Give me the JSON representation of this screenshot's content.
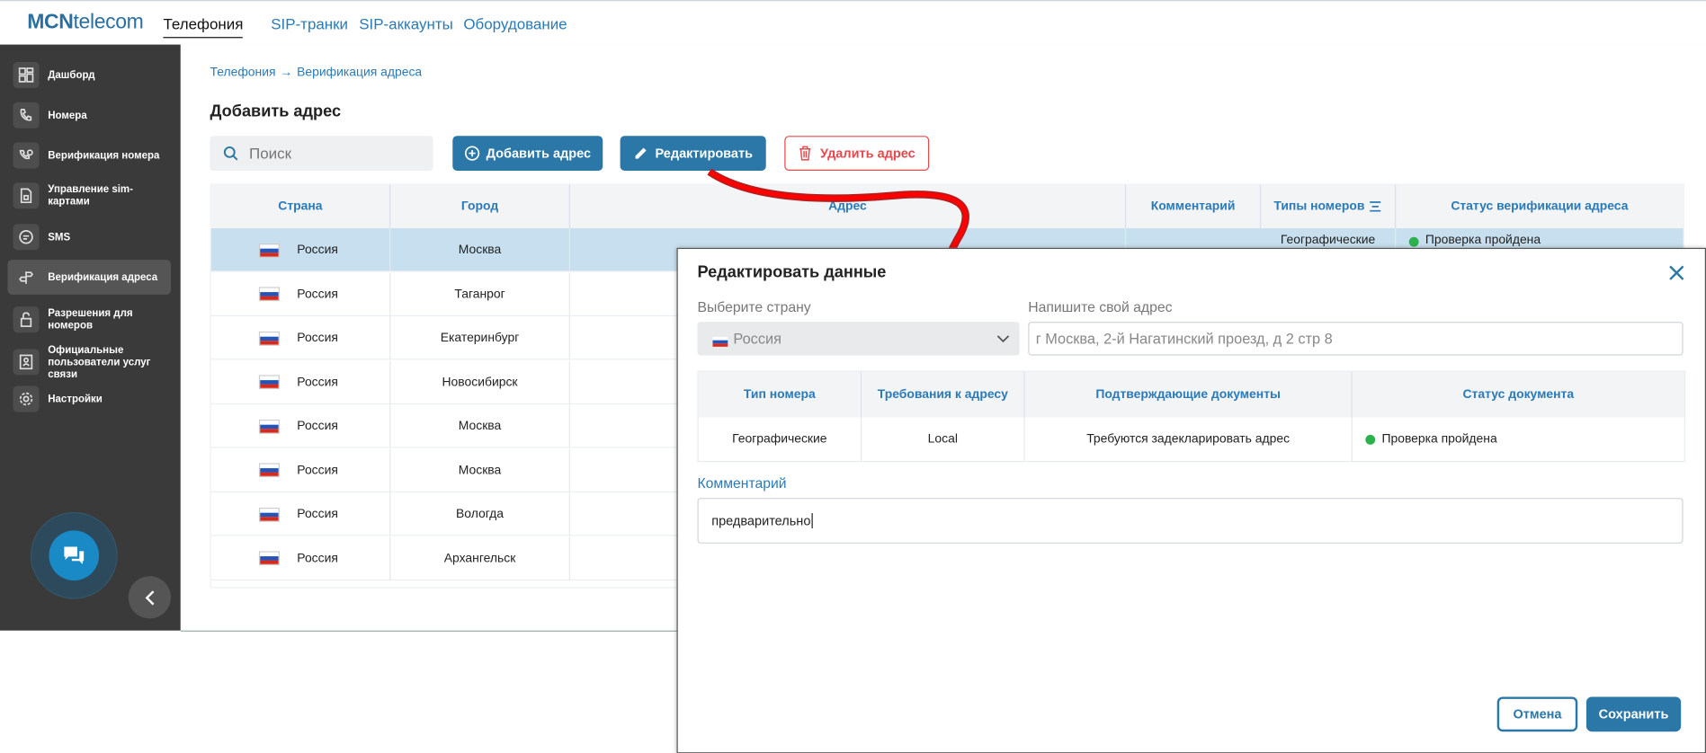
{
  "topbar": {
    "logo_bold": "MCN",
    "logo_thin": "telecom",
    "nav": [
      "Телефония",
      "SIP-транки",
      "SIP-аккаунты",
      "Оборудование"
    ]
  },
  "sidebar": {
    "items": [
      {
        "label": "Дашборд",
        "icon": "dashboard-icon"
      },
      {
        "label": "Номера",
        "icon": "phone-icon"
      },
      {
        "label": "Верификация номера",
        "icon": "number-verify-icon"
      },
      {
        "label": "Управление sim-картами",
        "icon": "sim-icon"
      },
      {
        "label": "SMS",
        "icon": "sms-icon"
      },
      {
        "label": "Верификация адреса",
        "icon": "signpost-icon"
      },
      {
        "label": "Разрешения для номеров",
        "icon": "lock-icon"
      },
      {
        "label": "Официальные пользователи услуг связи",
        "icon": "user-doc-icon"
      },
      {
        "label": "Настройки",
        "icon": "gear-icon"
      }
    ]
  },
  "main": {
    "breadcrumb": [
      "Телефония",
      "Верификация адреса"
    ],
    "title": "Добавить адрес",
    "search_placeholder": "Поиск",
    "buttons": {
      "add": "Добавить адрес",
      "edit": "Редактировать",
      "delete": "Удалить адрес"
    },
    "columns": [
      "Страна",
      "Город",
      "Адрес",
      "Комментарий",
      "Типы номеров",
      "Статус верификации адреса"
    ],
    "rows": [
      {
        "country": "Россия",
        "city": "Москва",
        "types": "Географические",
        "status": "Проверка пройдена"
      },
      {
        "country": "Россия",
        "city": "Таганрог"
      },
      {
        "country": "Россия",
        "city": "Екатеринбург"
      },
      {
        "country": "Россия",
        "city": "Новосибирск"
      },
      {
        "country": "Россия",
        "city": "Москва"
      },
      {
        "country": "Россия",
        "city": "Москва"
      },
      {
        "country": "Россия",
        "city": "Вологда"
      },
      {
        "country": "Россия",
        "city": "Архангельск"
      }
    ]
  },
  "modal": {
    "title": "Редактировать данные",
    "country_label": "Выберите страну",
    "country_value": "Россия",
    "address_label": "Напишите свой адрес",
    "address_value": "г Москва, 2-й Нагатинский проезд, д 2 стр 8",
    "columns": [
      "Тип номера",
      "Требования к адресу",
      "Подтверждающие документы",
      "Статус документа"
    ],
    "row": {
      "type": "Географические",
      "req": "Local",
      "docs": "Требуются задекларировать адрес",
      "status": "Проверка пройдена"
    },
    "comment_label": "Комментарий",
    "comment_value": "предварительно",
    "cancel": "Отмена",
    "save": "Сохранить"
  },
  "colors": {
    "accent": "#2a77a8",
    "danger": "#e5484d",
    "ok": "#2bb24c",
    "sidebar": "#3a3a3a"
  }
}
